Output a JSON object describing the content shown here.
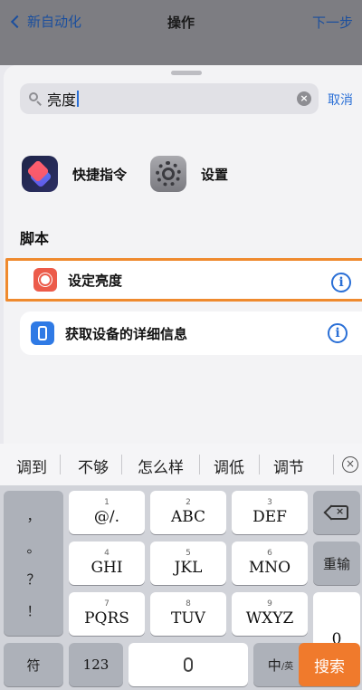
{
  "navbar": {
    "back_label": "新自动化",
    "title": "操作",
    "next_label": "下一步"
  },
  "search": {
    "value": "亮度",
    "cancel_label": "取消"
  },
  "apps": [
    {
      "label": "快捷指令",
      "icon": "shortcuts-app-icon"
    },
    {
      "label": "设置",
      "icon": "settings-gear-icon"
    }
  ],
  "section": {
    "title": "脚本"
  },
  "actions": [
    {
      "label": "设定亮度",
      "icon": "brightness-icon",
      "selected": true
    },
    {
      "label": "获取设备的详细信息",
      "icon": "device-icon",
      "selected": false
    }
  ],
  "predictions": [
    "调到",
    "不够",
    "怎么样",
    "调低",
    "调节"
  ],
  "keyboard": {
    "side_symbols": [
      "，",
      "。",
      "？",
      "！"
    ],
    "keys": [
      {
        "num": "1",
        "main": "@/."
      },
      {
        "num": "2",
        "main": "ABC"
      },
      {
        "num": "3",
        "main": "DEF"
      },
      {
        "num": "4",
        "main": "GHI"
      },
      {
        "num": "5",
        "main": "JKL"
      },
      {
        "num": "6",
        "main": "MNO"
      },
      {
        "num": "7",
        "main": "PQRS"
      },
      {
        "num": "8",
        "main": "TUV"
      },
      {
        "num": "9",
        "main": "WXYZ"
      }
    ],
    "retype_label": "重输",
    "zero_label": "0",
    "symbol_label": "符",
    "numbers_label": "123",
    "lang_label": "中",
    "lang_sub": "/英",
    "search_label": "搜索"
  },
  "colors": {
    "accent_blue": "#2a6fd6",
    "selection_orange": "#ef8a2e",
    "search_key": "#f07a2c"
  }
}
